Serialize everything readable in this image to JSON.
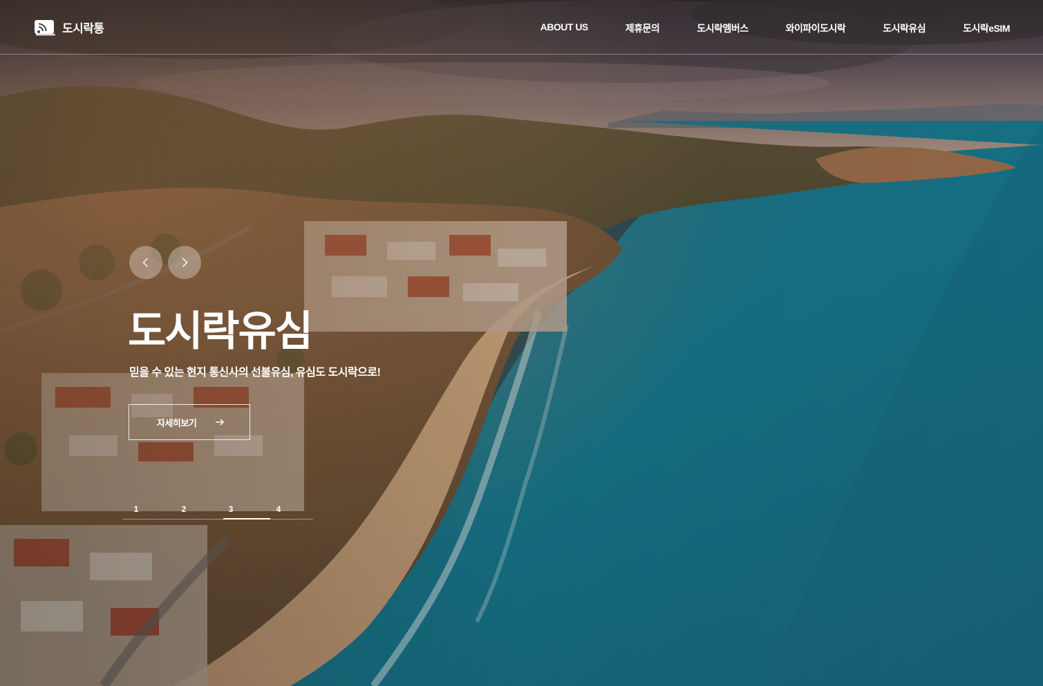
{
  "header": {
    "logo_text": "도시락통",
    "nav": [
      {
        "label": "ABOUT US"
      },
      {
        "label": "제휴문의"
      },
      {
        "label": "도시락멤버스"
      },
      {
        "label": "와이파이도시락"
      },
      {
        "label": "도시락유심"
      },
      {
        "label": "도시락eSIM"
      }
    ]
  },
  "hero": {
    "title": "도시락유심",
    "subtitle": "믿을 수 있는 현지 통신사의 선불유심, 유심도 도시락으로!",
    "cta_label": "자세히보기",
    "prev_icon": "chevron-left-icon",
    "next_icon": "chevron-right-icon"
  },
  "pagination": {
    "pages": [
      "1",
      "2",
      "3",
      "4"
    ],
    "active": "3"
  },
  "colors": {
    "text": "#ffffff",
    "sea": "#1f7f95",
    "sky": "#5a4a52"
  }
}
